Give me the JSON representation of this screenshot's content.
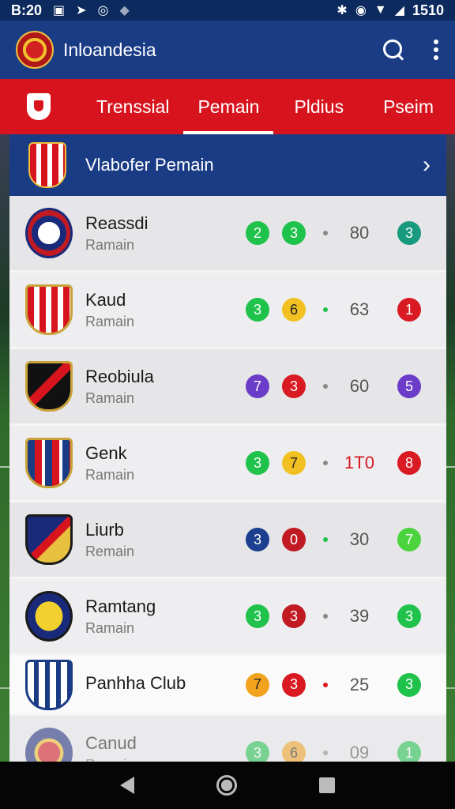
{
  "status_bar": {
    "time": "B:20",
    "icons_left": [
      "image-icon",
      "send-icon",
      "whatsapp-icon",
      "bird-icon"
    ],
    "icons_right": [
      "bluetooth-icon",
      "alarm-icon",
      "wifi-icon",
      "signal-icon"
    ],
    "right_text": "1510"
  },
  "app_bar": {
    "title": "Inloandesia",
    "logo": "club-logo",
    "actions": [
      "search-icon",
      "more-vert-icon"
    ]
  },
  "tabs": {
    "icon": "shield-icon",
    "items": [
      {
        "label": "Trenssial",
        "active": false
      },
      {
        "label": "Pemain",
        "active": true
      },
      {
        "label": "Pldius",
        "active": false
      },
      {
        "label": "Pseim",
        "active": false
      }
    ]
  },
  "list_header": {
    "title": "Vlabofer Pemain",
    "chevron": "chevron-right-icon"
  },
  "rows": [
    {
      "name": "Reassdi",
      "sub": "Ramain",
      "b1": "2",
      "b1c": "#1fc24a",
      "b2": "3",
      "b2c": "#1fc24a",
      "dotc": "#888888",
      "num": "80",
      "b3": "3",
      "b3c": "#179a7e"
    },
    {
      "name": "Kaud",
      "sub": "Ramain",
      "b1": "3",
      "b1c": "#1fc24a",
      "b2": "6",
      "b2c": "#f2c021",
      "dotc": "#1fc24a",
      "num": "63",
      "b3": "1",
      "b3c": "#d91a22"
    },
    {
      "name": "Reobiula",
      "sub": "Ramain",
      "b1": "7",
      "b1c": "#6a3cc8",
      "b2": "3",
      "b2c": "#d91a22",
      "dotc": "#888888",
      "num": "60",
      "b3": "5",
      "b3c": "#6a3cc8"
    },
    {
      "name": "Genk",
      "sub": "Ramain",
      "b1": "3",
      "b1c": "#1fc24a",
      "b2": "7",
      "b2c": "#f2c021",
      "dotc": "#888888",
      "num": "1T0",
      "numc": "#d91a22",
      "b3": "8",
      "b3c": "#d91a22"
    },
    {
      "name": "Liurb",
      "sub": "Remain",
      "b1": "3",
      "b1c": "#1c3f8f",
      "b2": "0",
      "b2c": "#c21a22",
      "dotc": "#1fc24a",
      "num": "30",
      "b3": "7",
      "b3c": "#4cd43e"
    },
    {
      "name": "Ramtang",
      "sub": "Ramain",
      "b1": "3",
      "b1c": "#1fc24a",
      "b2": "3",
      "b2c": "#c21a22",
      "dotc": "#888888",
      "num": "39",
      "b3": "3",
      "b3c": "#1fc24a"
    },
    {
      "name": "Panhha Club",
      "sub": "",
      "b1": "7",
      "b1c": "#f2a31e",
      "b2": "3",
      "b2c": "#d91a22",
      "dotc": "#d91a22",
      "num": "25",
      "b3": "3",
      "b3c": "#1fc24a"
    },
    {
      "name": "Canud",
      "sub": "Remain",
      "b1": "3",
      "b1c": "#1fc24a",
      "b2": "6",
      "b2c": "#f2a31e",
      "dotc": "#888888",
      "num": "09",
      "b3": "1",
      "b3c": "#1fc24a"
    }
  ],
  "nav_bar": [
    "back-icon",
    "home-icon",
    "recents-icon"
  ]
}
